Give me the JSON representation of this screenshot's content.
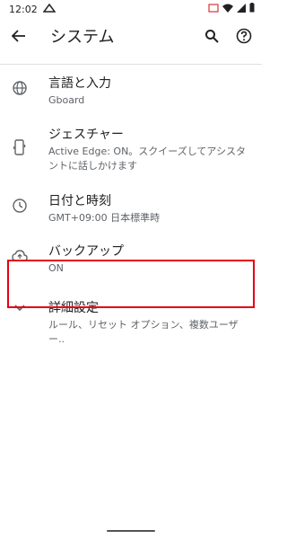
{
  "status_bar": {
    "time": "12:02"
  },
  "header": {
    "title": "システム"
  },
  "items": [
    {
      "title": "言語と入力",
      "subtitle": "Gboard"
    },
    {
      "title": "ジェスチャー",
      "subtitle": "Active Edge: ON。スクイーズしてアシスタントに話しかけます"
    },
    {
      "title": "日付と時刻",
      "subtitle": "GMT+09:00 日本標準時"
    },
    {
      "title": "バックアップ",
      "subtitle": "ON"
    },
    {
      "title": "詳細設定",
      "subtitle": "ルール、リセット オプション、複数ユーザー.."
    }
  ],
  "colors": {
    "highlight": "#e50012"
  }
}
